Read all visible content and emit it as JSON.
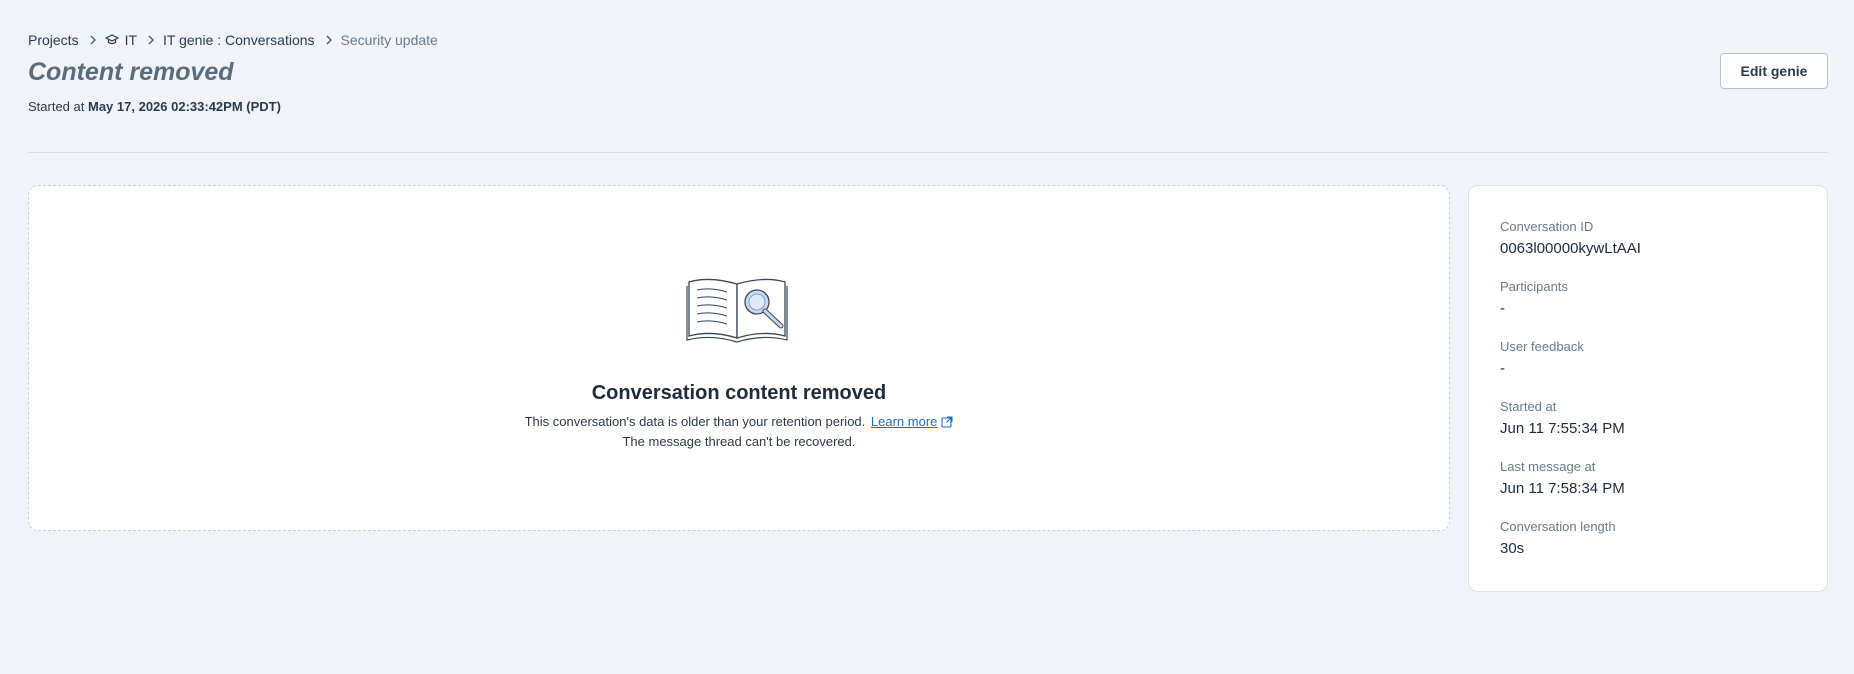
{
  "breadcrumb": {
    "items": [
      {
        "label": "Projects"
      },
      {
        "label": "IT",
        "icon": "graduation-cap-icon"
      },
      {
        "label": "IT genie : Conversations"
      },
      {
        "label": "Security update"
      }
    ]
  },
  "header": {
    "title": "Content removed",
    "started_prefix": "Started at",
    "started_value": "May 17, 2026 02:33:42PM (PDT)",
    "edit_button": "Edit genie"
  },
  "empty_state": {
    "illustration": "book-magnifier-illustration",
    "title": "Conversation content removed",
    "line1": "This conversation's data is older than your retention period.",
    "learn_more": "Learn more",
    "line2": "The message thread can't be recovered."
  },
  "details": {
    "items": [
      {
        "label": "Conversation ID",
        "value": "0063l00000kywLtAAI"
      },
      {
        "label": "Participants",
        "value": "-"
      },
      {
        "label": "User feedback",
        "value": "-"
      },
      {
        "label": "Started at",
        "value": "Jun 11 7:55:34 PM"
      },
      {
        "label": "Last message at",
        "value": "Jun 11 7:58:34 PM"
      },
      {
        "label": "Conversation length",
        "value": "30s"
      }
    ]
  },
  "colors": {
    "background": "#f0f4f8",
    "link": "#1b6fc0",
    "title_muted": "#5c6b7c"
  }
}
